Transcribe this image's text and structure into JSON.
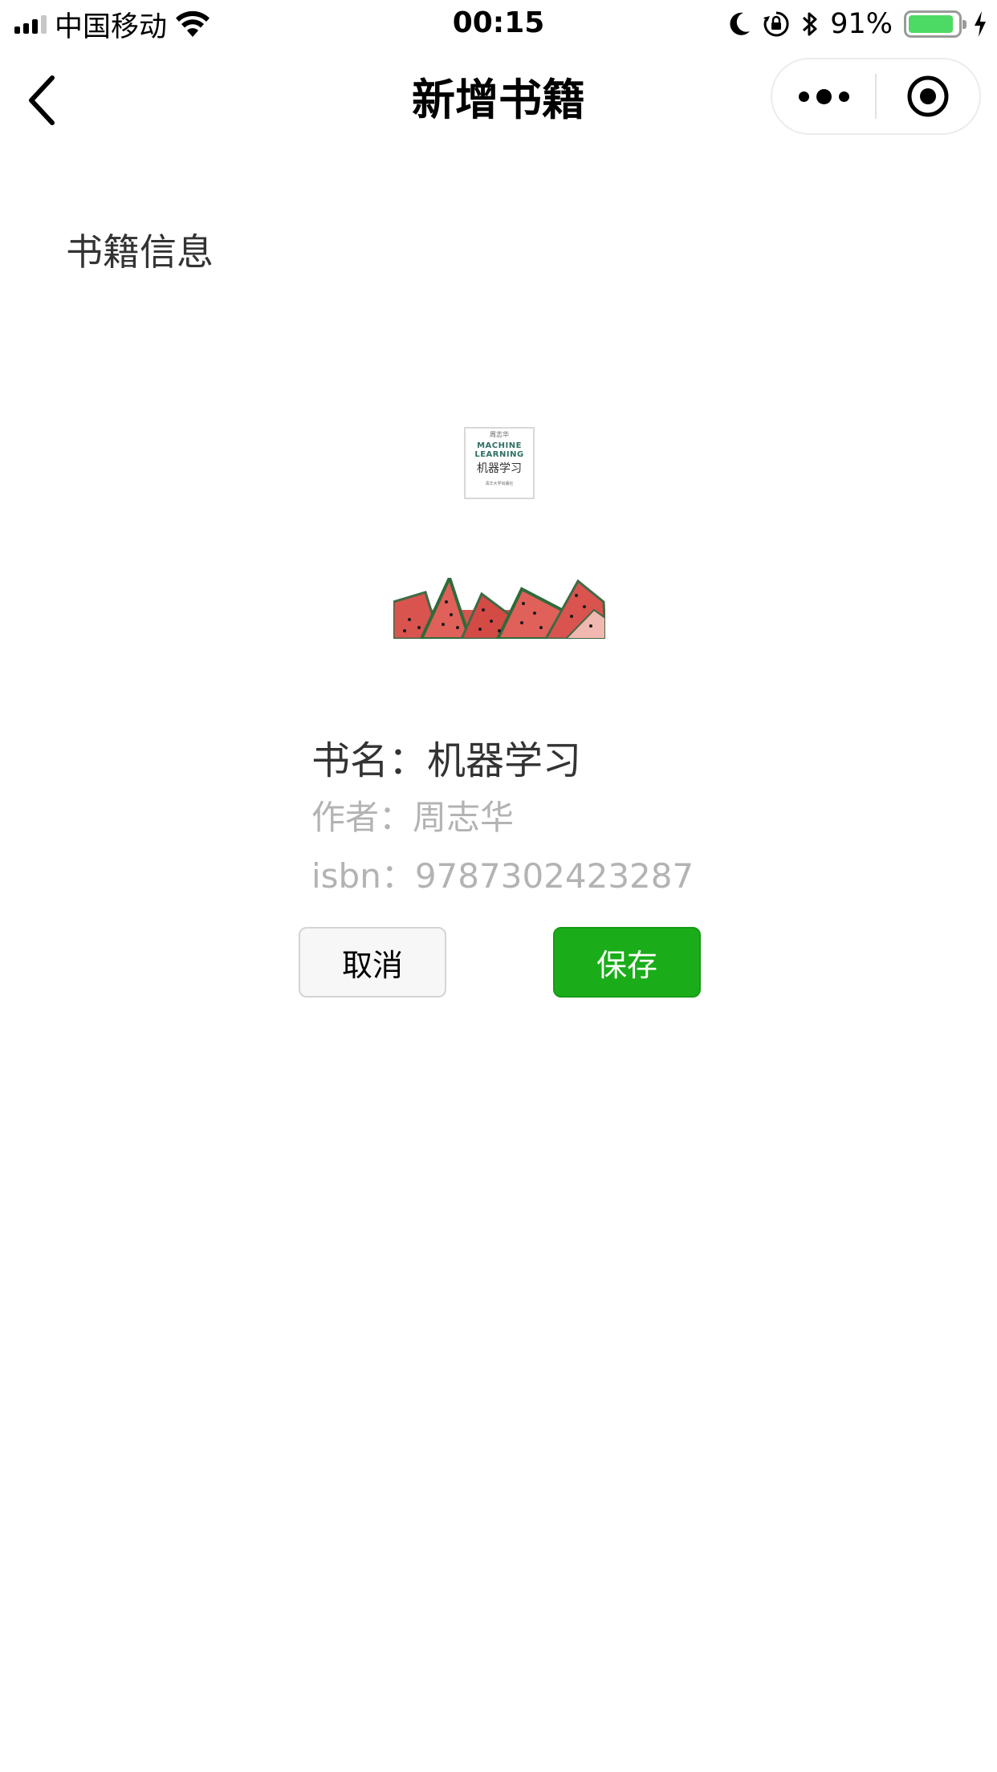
{
  "status_bar": {
    "carrier": "中国移动",
    "time": "00:15",
    "battery_percent": "91%",
    "battery_level": 0.91,
    "battery_color": "#4cd964",
    "icons": [
      "signal-icon",
      "wifi-icon",
      "moon-icon",
      "orientation-lock-icon",
      "bluetooth-icon",
      "battery-icon",
      "charging-icon"
    ]
  },
  "nav": {
    "title": "新增书籍",
    "back_icon": "chevron-left-icon",
    "menu_icon": "more-dots-icon",
    "close_icon": "target-circle-icon"
  },
  "content": {
    "section_label": "书籍信息",
    "cover": {
      "author": "周志华",
      "title_en_line1": "MACHINE",
      "title_en_line2": "LEARNING",
      "title_cn": "机器学习",
      "publisher": "清华大学出版社"
    },
    "book": {
      "name_text": "书名：机器学习",
      "author_text": "作者：周志华",
      "isbn_text": "isbn：9787302423287"
    },
    "buttons": {
      "cancel": "取消",
      "save": "保存"
    },
    "colors": {
      "save_button": "#1aad19",
      "secondary_text": "#b3b3b3",
      "primary_text": "#333333"
    }
  }
}
